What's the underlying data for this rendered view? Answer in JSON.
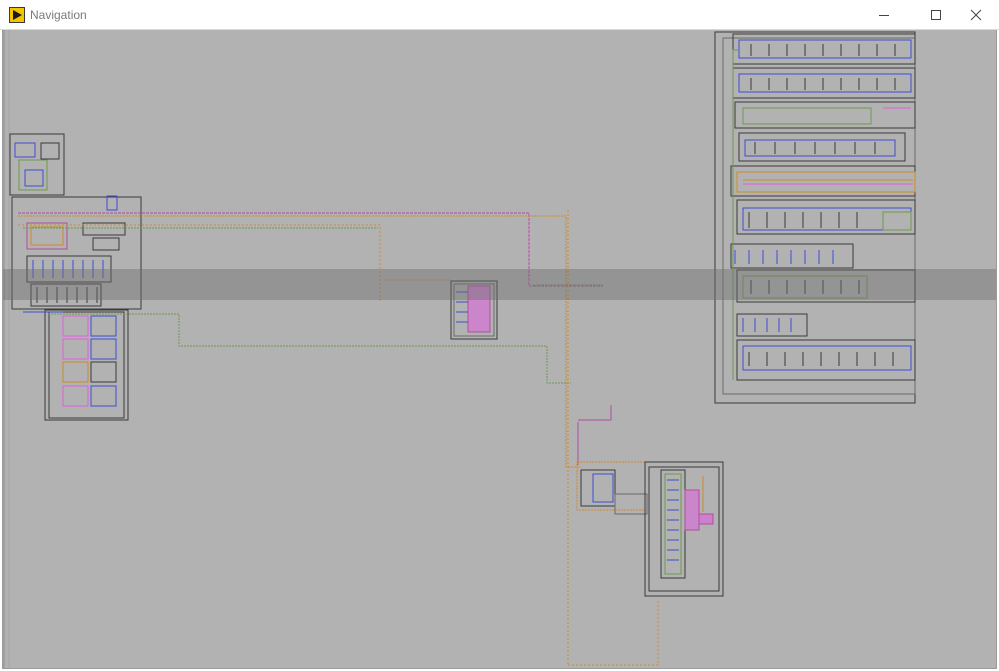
{
  "window": {
    "title": "Navigation",
    "app_icon": "labview-run-arrow-icon",
    "controls": [
      "minimize-icon",
      "maximize-icon",
      "close-icon"
    ]
  },
  "colors": {
    "canvas": "#b2b2b2",
    "wire_pink": "#b04fa0",
    "wire_orange": "#d08a2a",
    "wire_green": "#6f9a50",
    "wire_blue": "#3d4fd0",
    "wire_magenta": "#e060e0",
    "frame": "#3a3a3a",
    "nav_window": "#6e6e6e"
  }
}
